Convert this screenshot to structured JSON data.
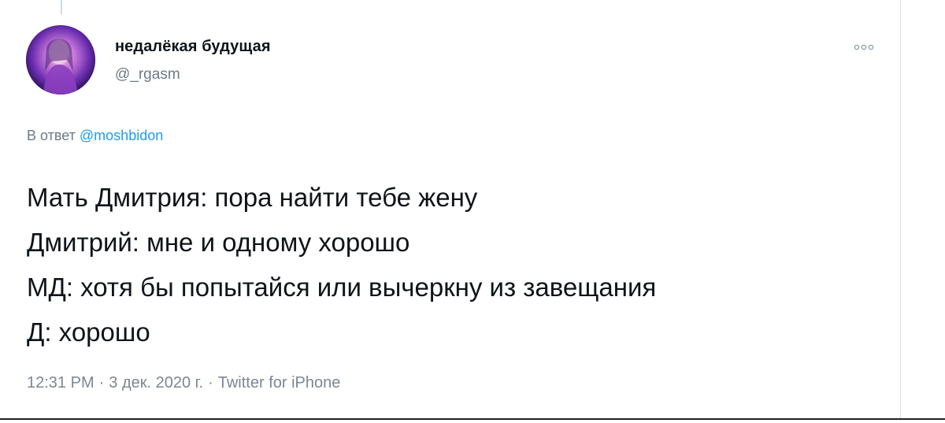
{
  "tweet": {
    "author_name": "недалёкая будущая",
    "author_handle": "@_rgasm",
    "reply_prefix": "В ответ",
    "reply_mention": "@moshbidon",
    "lines": [
      "Мать Дмитрия: пора найти тебе жену",
      "Дмитрий: мне и одному хорошо",
      "МД: хотя бы попытайся или вычеркну из завещания",
      "Д: хорошо"
    ],
    "time": "12:31 PM",
    "date": "3 дек. 2020 г.",
    "separator": "·",
    "source": "Twitter for iPhone"
  },
  "icons": {
    "more": "more-options-icon"
  },
  "colors": {
    "text_primary": "#0f1419",
    "text_secondary": "#6b7a86",
    "link": "#1d9bf0"
  }
}
